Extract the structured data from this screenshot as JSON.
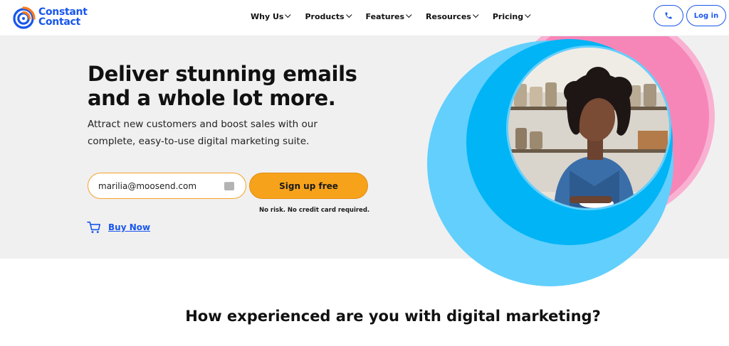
{
  "header": {
    "logo_line1": "Constant",
    "logo_line2": "Contact",
    "nav": [
      "Why Us",
      "Products",
      "Features",
      "Resources",
      "Pricing"
    ],
    "phone_icon": "phone-icon",
    "login_label": "Log in"
  },
  "hero": {
    "title": "Deliver stunning emails and a whole lot more.",
    "subtitle": "Attract new customers and boost sales with our complete, easy-to-use digital marketing suite.",
    "email_value": "marilia@moosend.com",
    "signup_label": "Sign up free",
    "disclaimer": "No risk. No credit card required.",
    "buy_now_label": "Buy Now",
    "colors": {
      "brand_blue": "#1856ed",
      "cta_orange": "#f7a21b",
      "ring_blue": "#63cffc",
      "ring_deep_blue": "#00b4f5",
      "ring_pink": "#f786b8",
      "ring_light_pink": "#f9b1d2"
    }
  },
  "section": {
    "question": "How experienced are you with digital marketing?"
  }
}
